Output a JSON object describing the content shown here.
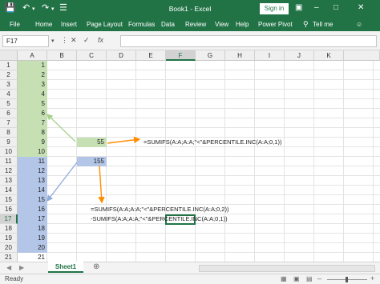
{
  "window": {
    "title": "Book1 - Excel",
    "sign_in": "Sign in"
  },
  "ribbon": {
    "tabs": [
      "File",
      "Home",
      "Insert",
      "Page Layout",
      "Formulas",
      "Data",
      "Review",
      "View",
      "Help",
      "Power Pivot",
      "Tell me"
    ]
  },
  "formula_bar": {
    "name_box": "F17",
    "fx": "fx",
    "content": ""
  },
  "columns": [
    "A",
    "B",
    "C",
    "D",
    "E",
    "F",
    "G",
    "H",
    "I",
    "J",
    "K"
  ],
  "active_column": "F",
  "rows": [
    "1",
    "2",
    "3",
    "4",
    "5",
    "6",
    "7",
    "8",
    "9",
    "10",
    "11",
    "12",
    "13",
    "14",
    "15",
    "16",
    "17",
    "18",
    "19",
    "20",
    "21"
  ],
  "active_row": "17",
  "column_a_values": [
    "1",
    "2",
    "3",
    "4",
    "5",
    "6",
    "7",
    "8",
    "9",
    "10",
    "11",
    "12",
    "13",
    "14",
    "15",
    "16",
    "17",
    "18",
    "19",
    "20",
    "21"
  ],
  "highlight": {
    "green": "#c6e0b4",
    "blue": "#b4c6e7",
    "arrow_green": "#a9d18e",
    "arrow_blue": "#8faadc",
    "arrow_orange": "#ff8c00"
  },
  "cells": {
    "c9": "55",
    "c11": "155"
  },
  "annotations": {
    "formula1": "=SUMIFS(A:A;A:A;\"<\"&PERCENTILE.INC(A:A;0,1))",
    "formula2_line1": "=SUMIFS(A:A;A:A;\"<\"&PERCENTILE.INC(A:A;0,2))",
    "formula2_line2": "-SUMIFS(A:A;A:A;\"<\"&PERCENTILE.INC(A:A;0,1))"
  },
  "sheets": [
    "Sheet1"
  ],
  "status": "Ready"
}
